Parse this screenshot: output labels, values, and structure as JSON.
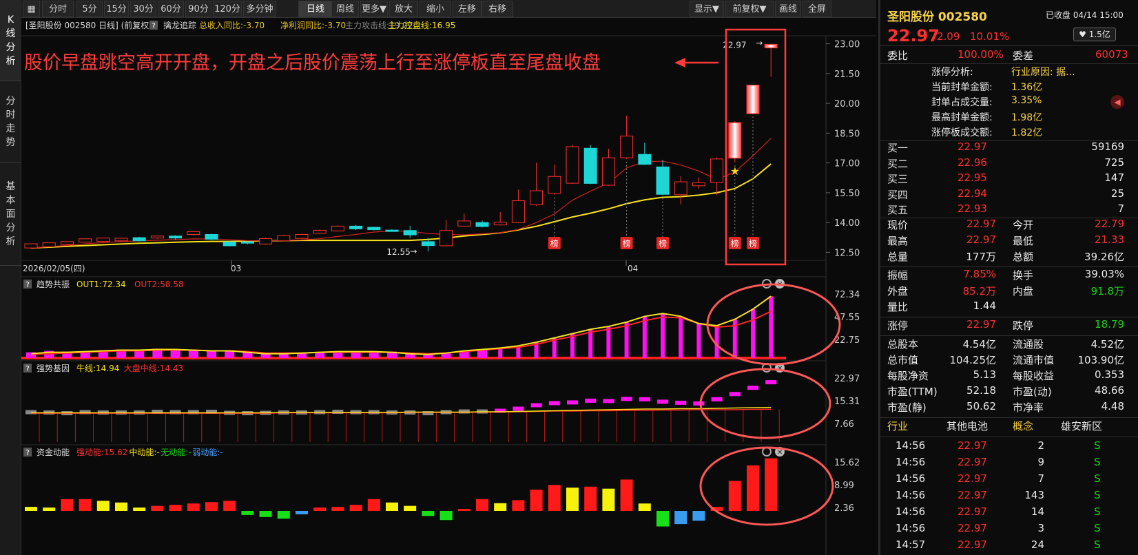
{
  "leftnav": [
    {
      "label": "K\n线\n分\n析",
      "active": true
    },
    {
      "label": "分\n时\n走\n势",
      "active": false
    },
    {
      "label": "基\n本\n面\n分\n析",
      "active": false
    }
  ],
  "toolbar": {
    "left": [
      "分时",
      "1分",
      "5分",
      "15分",
      "30分",
      "60分",
      "90分",
      "120分",
      "多分钟",
      "日线",
      "周线",
      "更多▼",
      "放大",
      "缩小",
      "左移",
      "右移"
    ],
    "active": "日线",
    "right": [
      "显示▼",
      "前复权▼",
      "画线",
      "全屏"
    ]
  },
  "main": {
    "title": "[圣阳股份 002580 日线]",
    "adjust": "(前复权)",
    "q": "?",
    "indicator": "擒龙追踪",
    "rev_label": "总收入同比:-3.70",
    "profit_label": "净利润同比:-3.70",
    "attack_label": "主力攻击线:19.22",
    "control_label": "主力控盘线:16.95",
    "annotation": "股价早盘跳空高开开盘，开盘之后股价震荡上行至涨停板直至尾盘收盘",
    "arrow": "◀━━",
    "ylabels": [
      "23.00",
      "21.50",
      "20.00",
      "18.50",
      "17.00",
      "15.50",
      "14.00",
      "12.50"
    ],
    "date_first": "2026/02/05(四)",
    "date_03": "03",
    "date_04": "04",
    "low_label": "12.55",
    "high_label": "22.97",
    "bang": "榜"
  },
  "panels": [
    {
      "name": "趋势共振",
      "q": "?",
      "labels": [
        {
          "t": "OUT1:72.34",
          "c": "#f7e21a"
        },
        {
          "t": "OUT2:58.58",
          "c": "#ff3030"
        }
      ],
      "ylabels": [
        "72.34",
        "47.55",
        "22.75"
      ]
    },
    {
      "name": "强势基因",
      "q": "?",
      "labels": [
        {
          "t": "牛线:14.94",
          "c": "#f7e21a"
        },
        {
          "t": "大盘中线:14.43",
          "c": "#ff3030"
        }
      ],
      "ylabels": [
        "22.97",
        "15.31",
        "7.66"
      ]
    },
    {
      "name": "资金动能",
      "q": "?",
      "labels": [
        {
          "t": "强动能:15.62",
          "c": "#ff3030"
        },
        {
          "t": "中动能:-",
          "c": "#f7e21a"
        },
        {
          "t": "无动能:-",
          "c": "#19d219"
        },
        {
          "t": "弱动能:-",
          "c": "#4aa0ff"
        }
      ],
      "ylabels": [
        "15.62",
        "8.99",
        "2.36"
      ]
    }
  ],
  "chart_data": {
    "type": "candlestick",
    "ohlc": [
      [
        12.72,
        12.93,
        12.7,
        12.9
      ],
      [
        12.78,
        12.98,
        12.74,
        12.9
      ],
      [
        12.9,
        13.04,
        12.86,
        13.0
      ],
      [
        13.02,
        13.18,
        12.99,
        13.14
      ],
      [
        13.05,
        13.22,
        13.01,
        13.13
      ],
      [
        13.08,
        13.21,
        13.03,
        13.15
      ],
      [
        13.24,
        13.08,
        13.05,
        13.28
      ],
      [
        13.22,
        13.32,
        13.18,
        13.3
      ],
      [
        13.32,
        13.22,
        13.14,
        13.36
      ],
      [
        13.4,
        13.54,
        13.36,
        13.52
      ],
      [
        13.4,
        13.16,
        13.12,
        13.44
      ],
      [
        13.02,
        12.83,
        12.8,
        13.06
      ],
      [
        13.03,
        12.97,
        12.9,
        13.07
      ],
      [
        12.92,
        13.19,
        12.89,
        13.24
      ],
      [
        13.08,
        13.34,
        13.05,
        13.38
      ],
      [
        13.2,
        13.4,
        13.16,
        13.44
      ],
      [
        13.46,
        13.61,
        13.42,
        13.64
      ],
      [
        13.58,
        13.82,
        13.55,
        13.86
      ],
      [
        13.82,
        13.68,
        13.62,
        13.88
      ],
      [
        13.76,
        13.64,
        13.6,
        13.79
      ],
      [
        13.62,
        13.6,
        13.54,
        13.66
      ],
      [
        13.6,
        13.38,
        13.22,
        13.84
      ],
      [
        13.04,
        12.84,
        12.55,
        13.22
      ],
      [
        12.83,
        13.6,
        12.8,
        14.13
      ],
      [
        13.82,
        14.08,
        13.8,
        14.45
      ],
      [
        14.0,
        13.8,
        13.76,
        14.1
      ],
      [
        13.88,
        14.02,
        13.85,
        14.53
      ],
      [
        14.0,
        15.1,
        13.98,
        15.66
      ],
      [
        14.9,
        15.6,
        14.83,
        17.01
      ],
      [
        15.47,
        16.32,
        15.4,
        16.93
      ],
      [
        15.98,
        17.82,
        15.94,
        17.91
      ],
      [
        17.74,
        15.97,
        15.93,
        17.9
      ],
      [
        15.88,
        17.26,
        15.85,
        17.71
      ],
      [
        17.26,
        18.35,
        17.2,
        19.38
      ],
      [
        17.43,
        16.93,
        16.9,
        18.02
      ],
      [
        16.8,
        15.42,
        15.38,
        17.15
      ],
      [
        15.4,
        16.05,
        14.92,
        16.33
      ],
      [
        15.85,
        16.0,
        15.7,
        16.28
      ],
      [
        16.02,
        17.2,
        15.4,
        17.28
      ],
      [
        17.24,
        19.03,
        17.02,
        19.1
      ],
      [
        19.48,
        20.92,
        19.48,
        20.92
      ],
      [
        22.79,
        22.97,
        21.33,
        22.97
      ]
    ],
    "up_color": "#ff2f2f",
    "down_color": "#1fd6d6",
    "ma_red": [
      12.72,
      12.78,
      12.85,
      12.93,
      12.99,
      13.04,
      13.08,
      13.11,
      13.14,
      13.18,
      13.17,
      13.13,
      13.09,
      13.07,
      13.1,
      13.12,
      13.19,
      13.3,
      13.4,
      13.52,
      13.58,
      13.56,
      13.45,
      13.4,
      13.38,
      13.43,
      13.49,
      13.65,
      14.0,
      14.43,
      15.13,
      15.58,
      15.99,
      16.75,
      17.06,
      17.09,
      16.9,
      16.59,
      16.17,
      16.54,
      17.36,
      18.24
    ],
    "ma_yellow": [
      12.72,
      12.76,
      12.8,
      12.84,
      12.88,
      12.92,
      12.96,
      12.98,
      13.01,
      13.03,
      13.05,
      13.05,
      13.06,
      13.08,
      13.09,
      13.1,
      13.1,
      13.1,
      13.1,
      13.1,
      13.1,
      13.1,
      13.15,
      13.22,
      13.32,
      13.4,
      13.48,
      13.63,
      13.81,
      14.04,
      14.28,
      14.47,
      14.69,
      14.95,
      15.14,
      15.27,
      15.3,
      15.38,
      15.5,
      15.71,
      16.2,
      16.95
    ],
    "ylim": [
      12.1,
      23.4
    ],
    "bang_idx": [
      29,
      33,
      35,
      39,
      40
    ],
    "star_idx": 39,
    "trend_bars": [
      8,
      10,
      9,
      9,
      11,
      12,
      12,
      13,
      12,
      11,
      10,
      11,
      8,
      6,
      6,
      7,
      8,
      9,
      8,
      8,
      9,
      6,
      5,
      7,
      10,
      12,
      14,
      16,
      22,
      28,
      34,
      40,
      44,
      50,
      58,
      62,
      58,
      48,
      45,
      54,
      68,
      86
    ],
    "trend_yellow": [
      6,
      8,
      8,
      9,
      10,
      11,
      11,
      12,
      12,
      11,
      10,
      10,
      8,
      6,
      6,
      7,
      8,
      9,
      9,
      9,
      8,
      6,
      5,
      7,
      10,
      12,
      14,
      17,
      22,
      28,
      34,
      40,
      44,
      50,
      58,
      62,
      58,
      48,
      45,
      54,
      68,
      86
    ],
    "trend_red": [
      5,
      6,
      7,
      8,
      9,
      10,
      10,
      11,
      11,
      11,
      10,
      10,
      9,
      7,
      7,
      7,
      8,
      8,
      8,
      8,
      8,
      7,
      6,
      7,
      9,
      11,
      13,
      15,
      19,
      25,
      30,
      36,
      40,
      45,
      52,
      57,
      56,
      48,
      43,
      45,
      53,
      65
    ],
    "gene_mag": [
      13.6,
      13.5,
      13.3,
      13.6,
      13.5,
      13.5,
      13.5,
      13.7,
      13.6,
      13.6,
      13.7,
      13.4,
      13.3,
      13.4,
      13.5,
      13.5,
      13.6,
      13.7,
      13.6,
      13.6,
      13.5,
      13.5,
      13.3,
      13.6,
      13.8,
      13.8,
      14.0,
      14.6,
      15.6,
      16.2,
      16.4,
      16.9,
      16.8,
      17.4,
      17.3,
      16.6,
      16.3,
      16.1,
      17.3,
      18.8,
      20.6,
      22.2
    ],
    "gene_bull": [
      13.4,
      13.4,
      13.4,
      13.4,
      13.4,
      13.4,
      13.4,
      13.4,
      13.4,
      13.4,
      13.4,
      13.4,
      13.4,
      13.4,
      13.5,
      13.5,
      13.5,
      13.5,
      13.5,
      13.5,
      13.5,
      13.6,
      13.6,
      13.6,
      13.6,
      13.7,
      13.7,
      13.8,
      13.9,
      14.0,
      14.1,
      14.2,
      14.3,
      14.4,
      14.5,
      14.5,
      14.6,
      14.6,
      14.7,
      14.8,
      14.9,
      14.94
    ],
    "gene_mid": [
      13.3,
      13.3,
      13.3,
      13.3,
      13.3,
      13.3,
      13.3,
      13.3,
      13.3,
      13.3,
      13.3,
      13.3,
      13.3,
      13.3,
      13.4,
      13.4,
      13.4,
      13.4,
      13.4,
      13.4,
      13.4,
      13.5,
      13.5,
      13.5,
      13.5,
      13.6,
      13.6,
      13.7,
      13.8,
      13.9,
      13.9,
      14.0,
      14.0,
      14.1,
      14.1,
      14.2,
      14.2,
      14.3,
      14.3,
      14.3,
      14.4,
      14.43
    ],
    "fund_vals": [
      1.2,
      1.0,
      3.5,
      3.5,
      3.0,
      2.5,
      1.0,
      1.5,
      1.8,
      2.2,
      2.6,
      3.0,
      -1.2,
      -1.8,
      -2.3,
      -1.0,
      1.0,
      1.2,
      1.8,
      3.5,
      2.5,
      1.5,
      -1.5,
      -2.7,
      0.6,
      3.5,
      2.3,
      3.2,
      6.3,
      7.7,
      6.9,
      7.2,
      6.6,
      9.3,
      2.2,
      -4.6,
      -3.9,
      -2.9,
      1.2,
      8.9,
      13.5,
      15.6
    ],
    "fund_colors": [
      "y",
      "y",
      "r",
      "r",
      "y",
      "y",
      "y",
      "r",
      "r",
      "r",
      "r",
      "r",
      "g",
      "g",
      "g",
      "b",
      "r",
      "r",
      "r",
      "r",
      "y",
      "y",
      "g",
      "g",
      "r",
      "r",
      "y",
      "r",
      "r",
      "r",
      "y",
      "r",
      "y",
      "r",
      "y",
      "g",
      "b",
      "b",
      "r",
      "r",
      "r",
      "r"
    ]
  },
  "right": {
    "name": "圣阳股份 002580",
    "closed": "已收盘 04/14 15:00",
    "price": "22.97",
    "chg": "2.09",
    "pct": "10.01%",
    "fav_btn": "♥ 1.5亿",
    "wb_l": "委比",
    "wb_v": "100.00%",
    "wc_l": "委差",
    "wc_v": "60073",
    "zt": [
      {
        "l": "涨停分析:",
        "v": "行业原因: 据..."
      },
      {
        "l": "当前封单金额:",
        "v": "1.36亿"
      },
      {
        "l": "封单占成交量:",
        "v": "3.35%"
      },
      {
        "l": "最高封单金额:",
        "v": "1.98亿"
      },
      {
        "l": "涨停板成交额:",
        "v": "1.82亿"
      }
    ],
    "buys": [
      {
        "l": "买一",
        "p": "22.97",
        "v": "59169"
      },
      {
        "l": "买二",
        "p": "22.96",
        "v": "725"
      },
      {
        "l": "买三",
        "p": "22.95",
        "v": "147"
      },
      {
        "l": "买四",
        "p": "22.94",
        "v": "25"
      },
      {
        "l": "买五",
        "p": "22.93",
        "v": "7"
      }
    ],
    "stats": [
      {
        "a": "现价",
        "av": "22.97",
        "ac": "r",
        "b": "今开",
        "bv": "22.79",
        "bc": "r"
      },
      {
        "a": "最高",
        "av": "22.97",
        "ac": "r",
        "b": "最低",
        "bv": "21.33",
        "bc": "r"
      },
      {
        "a": "总量",
        "av": "177万",
        "ac": "w",
        "b": "总额",
        "bv": "39.26亿",
        "bc": "w"
      },
      {
        "sep": true
      },
      {
        "a": "振幅",
        "av": "7.85%",
        "ac": "r",
        "b": "换手",
        "bv": "39.03%",
        "bc": "w"
      },
      {
        "a": "外盘",
        "av": "85.2万",
        "ac": "r",
        "b": "内盘",
        "bv": "91.8万",
        "bc": "g"
      },
      {
        "a": "量比",
        "av": "1.44",
        "ac": "w",
        "b": "",
        "bv": "",
        "bc": "w"
      },
      {
        "sep": true
      },
      {
        "a": "涨停",
        "av": "22.97",
        "ac": "r",
        "b": "跌停",
        "bv": "18.79",
        "bc": "g"
      },
      {
        "sep": true
      },
      {
        "a": "总股本",
        "av": "4.54亿",
        "ac": "w",
        "b": "流通股",
        "bv": "4.52亿",
        "bc": "w"
      },
      {
        "a": "总市值",
        "av": "104.25亿",
        "ac": "w",
        "b": "流通市值",
        "bv": "103.90亿",
        "bc": "w"
      },
      {
        "a": "每股净资",
        "av": "5.13",
        "ac": "w",
        "b": "每股收益",
        "bv": "0.353",
        "bc": "w"
      },
      {
        "a": "市盈(TTM)",
        "av": "52.18",
        "ac": "w",
        "b": "市盈(动)",
        "bv": "48.66",
        "bc": "w"
      },
      {
        "a": "市盈(静)",
        "av": "50.62",
        "ac": "w",
        "b": "市净率",
        "bv": "4.48",
        "bc": "w"
      }
    ],
    "industry_l": "行业",
    "industry_v": "其他电池",
    "concept_l": "概念",
    "concept_v": "雄安新区",
    "ticks": [
      {
        "t": "14:56",
        "p": "22.97",
        "v": "2",
        "s": "S"
      },
      {
        "t": "14:56",
        "p": "22.97",
        "v": "9",
        "s": "S"
      },
      {
        "t": "14:56",
        "p": "22.97",
        "v": "7",
        "s": "S"
      },
      {
        "t": "14:56",
        "p": "22.97",
        "v": "143",
        "s": "S"
      },
      {
        "t": "14:56",
        "p": "22.97",
        "v": "14",
        "s": "S"
      },
      {
        "t": "14:56",
        "p": "22.97",
        "v": "3",
        "s": "S"
      },
      {
        "t": "14:57",
        "p": "22.97",
        "v": "24",
        "s": "S"
      }
    ]
  }
}
